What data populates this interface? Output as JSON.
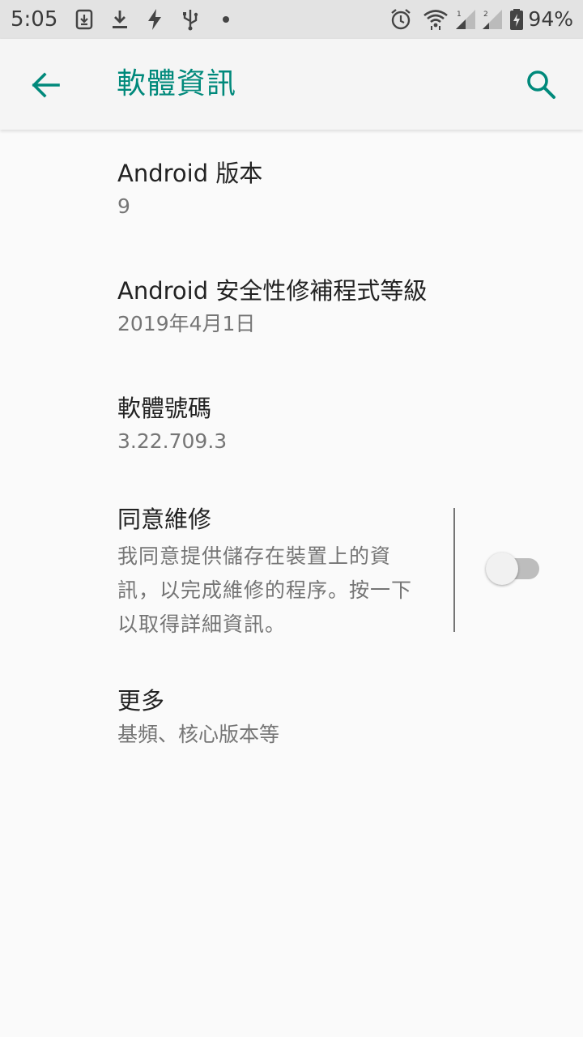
{
  "status_bar": {
    "time": "5:05",
    "battery_percent": "94%",
    "icons": [
      "download-box-icon",
      "download-icon",
      "flash-icon",
      "usb-icon",
      "dot-icon",
      "alarm-icon",
      "wifi-icon",
      "signal-icon",
      "signal-icon-2",
      "battery-charging-icon"
    ]
  },
  "app_bar": {
    "title": "軟體資訊",
    "accent_color": "#00897b"
  },
  "items": [
    {
      "title": "Android 版本",
      "summary": "9"
    },
    {
      "title": "Android 安全性修補程式等級",
      "summary": "2019年4月1日"
    },
    {
      "title": "軟體號碼",
      "summary": "3.22.709.3"
    },
    {
      "title": "同意維修",
      "summary": "我同意提供儲存在裝置上的資訊，以完成維修的程序。按一下以取得詳細資訊。",
      "switch_on": false
    },
    {
      "title": "更多",
      "summary": "基頻、核心版本等"
    }
  ]
}
